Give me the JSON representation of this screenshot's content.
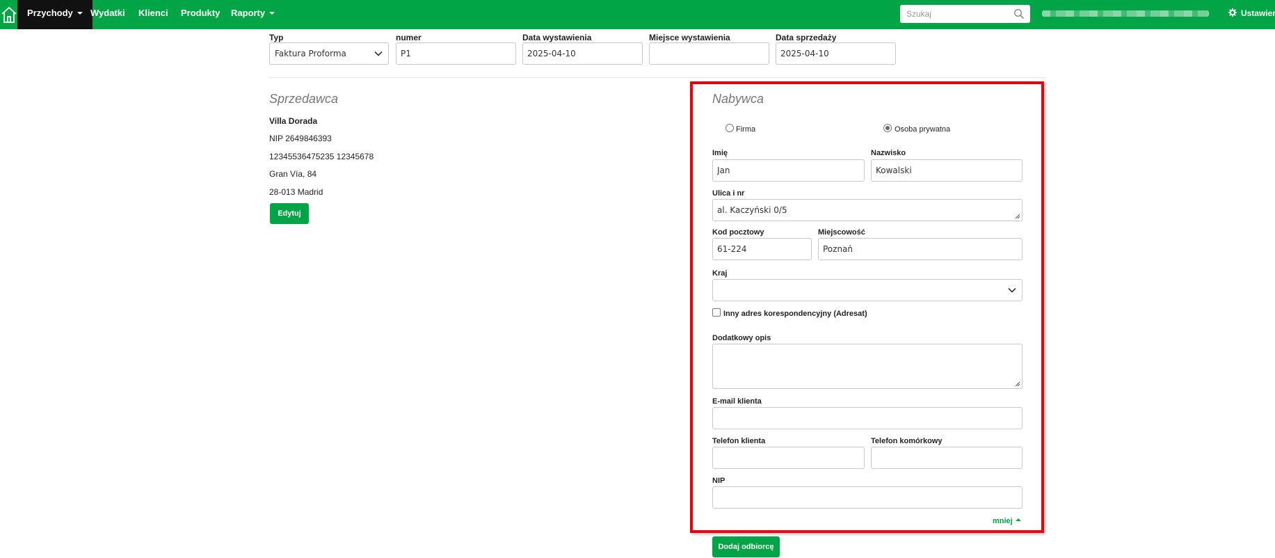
{
  "nav": {
    "items": [
      {
        "label": "Przychody",
        "caret": true,
        "active": true
      },
      {
        "label": "Wydatki"
      },
      {
        "label": "Klienci"
      },
      {
        "label": "Produkty"
      },
      {
        "label": "Raporty",
        "caret": true
      }
    ],
    "search_placeholder": "Szukaj",
    "settings_label": "Ustawienia",
    "brand_color": "#02a546"
  },
  "invoice": {
    "type_label": "Typ",
    "type_value": "Faktura Proforma",
    "number_label": "numer",
    "number_value": "P1",
    "issue_date_label": "Data wystawienia",
    "issue_date_value": "2025-04-10",
    "issue_place_label": "Miejsce wystawienia",
    "issue_place_value": "",
    "sale_date_label": "Data sprzedaży",
    "sale_date_value": "2025-04-10"
  },
  "seller": {
    "title": "Sprzedawca",
    "name": "Villa Dorada",
    "nip": "NIP 2649846393",
    "account": "12345536475235 12345678",
    "street": "Gran Vía, 84",
    "city": "28-013 Madrid",
    "edit_label": "Edytuj"
  },
  "buyer": {
    "title": "Nabywca",
    "radio_company": "Firma",
    "radio_private": "Osoba prywatna",
    "selected": "Osoba prywatna",
    "first_name_label": "Imię",
    "first_name_value": "Jan",
    "last_name_label": "Nazwisko",
    "last_name_value": "Kowalski",
    "street_label": "Ulica i nr",
    "street_value": "al. Kaczyński 0/5",
    "postal_label": "Kod pocztowy",
    "postal_value": "61-224",
    "city_label": "Miejscowość",
    "city_value": "Poznań",
    "country_label": "Kraj",
    "country_value": "",
    "alt_address_label": "Inny adres korespondencyjny (Adresat)",
    "alt_address_checked": false,
    "extra_desc_label": "Dodatkowy opis",
    "extra_desc_value": "",
    "email_label": "E-mail klienta",
    "email_value": "",
    "phone_label": "Telefon klienta",
    "phone_value": "",
    "mobile_label": "Telefon komórkowy",
    "mobile_value": "",
    "nip_label": "NIP",
    "nip_value": "",
    "less_label": "mniej",
    "add_recipient_label": "Dodaj odbiorcę",
    "highlight_color": "#e8000b"
  }
}
